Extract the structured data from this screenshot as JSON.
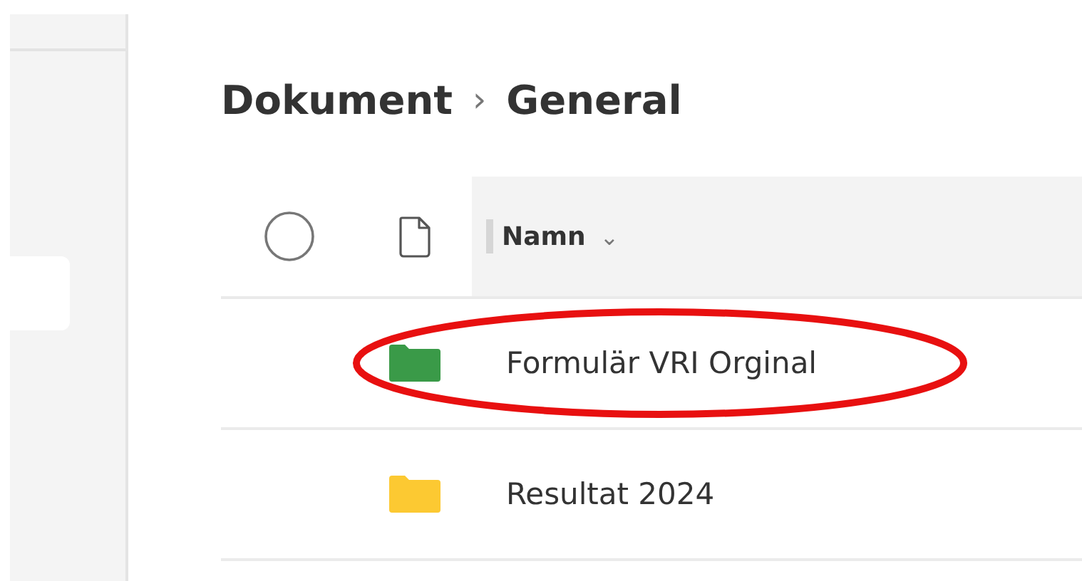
{
  "breadcrumb": [
    {
      "label": "Dokument"
    },
    {
      "label": "General"
    }
  ],
  "breadcrumb_separator": "›",
  "header": {
    "name_column": "Namn",
    "sort_caret": "⌄"
  },
  "rows": [
    {
      "name": "Formulär VRI Orginal",
      "color": "#3a9a48",
      "circled": true
    },
    {
      "name": "Resultat 2024",
      "color": "#fcc932",
      "circled": false
    }
  ]
}
